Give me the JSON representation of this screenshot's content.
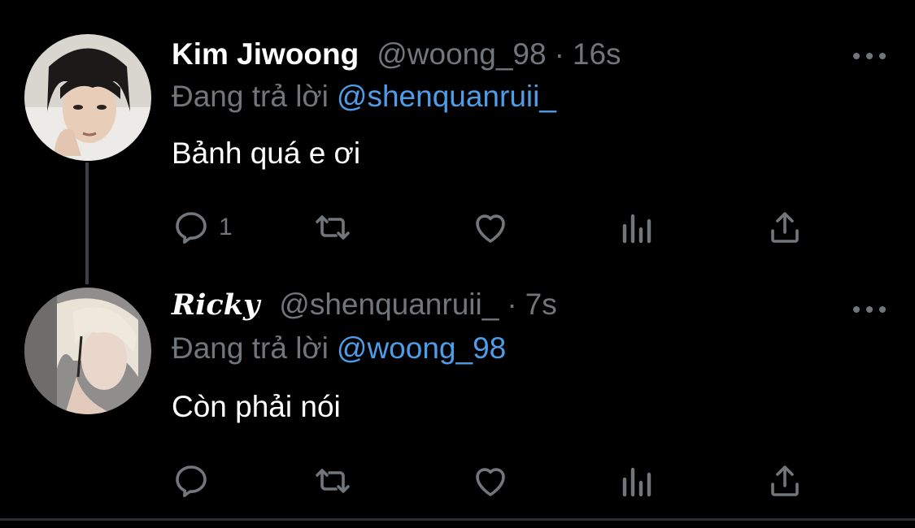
{
  "tweets": [
    {
      "display_name": "Kim Jiwoong",
      "handle": "@woong_98",
      "separator": "·",
      "time": "16s",
      "reply_prefix": "Đang trả lời",
      "reply_to": "@shenquanruii_",
      "text": "Bảnh quá e ơi",
      "reply_count": "1"
    },
    {
      "display_name": "Ricky",
      "handle": "@shenquanruii_",
      "separator": "·",
      "time": "7s",
      "reply_prefix": "Đang trả lời",
      "reply_to": "@woong_98",
      "text": "Còn phải nói",
      "reply_count": ""
    }
  ],
  "colors": {
    "background": "#000000",
    "secondary_text": "#71767b",
    "mention": "#4e9de6",
    "thread_line": "#3d4046"
  },
  "icons": [
    "reply-icon",
    "retweet-icon",
    "like-icon",
    "analytics-icon",
    "share-icon",
    "more-icon"
  ]
}
